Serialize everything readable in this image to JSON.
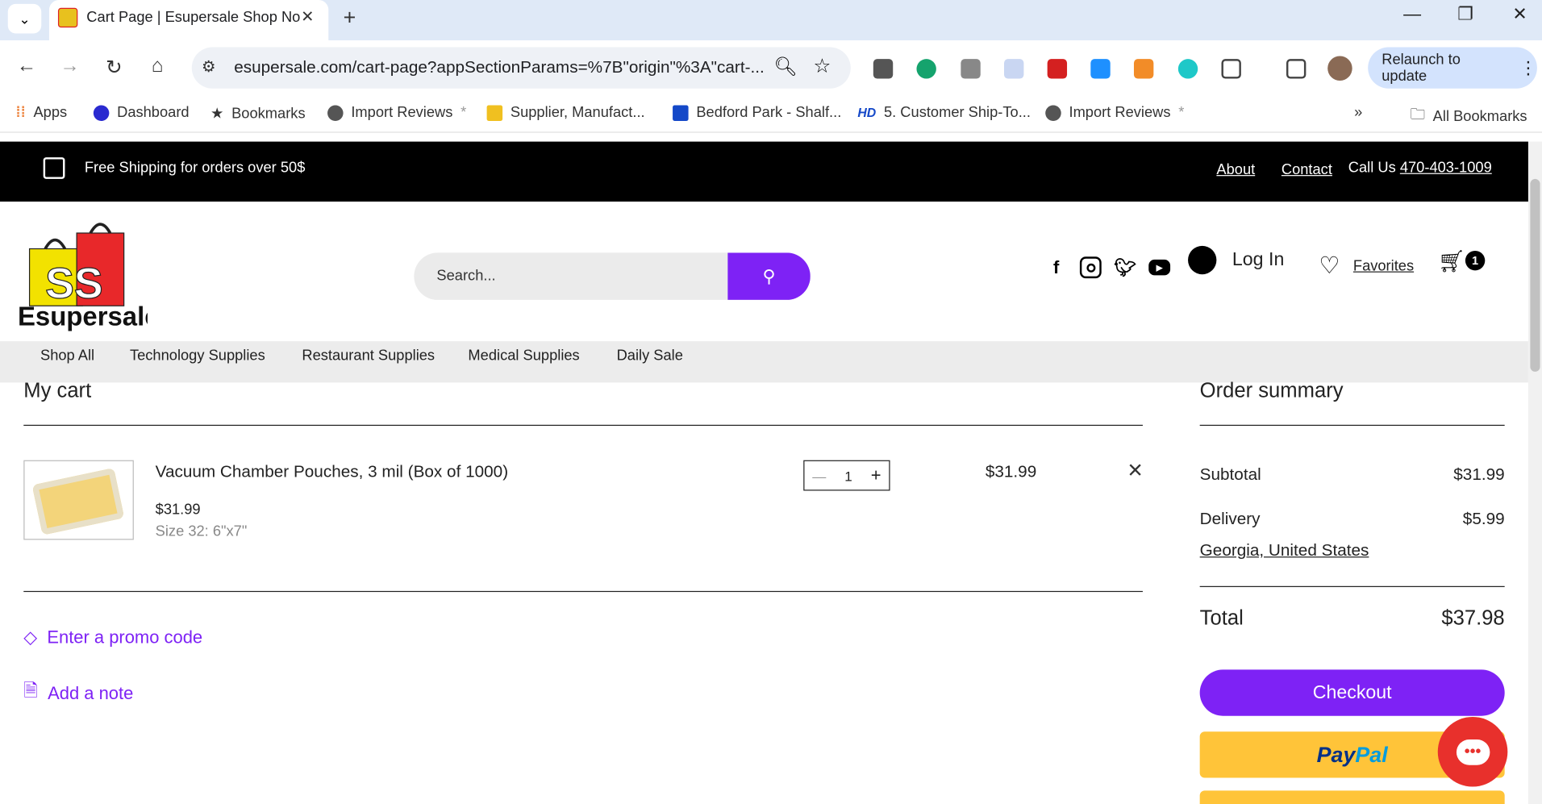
{
  "browser": {
    "tab_title": "Cart Page | Esupersale Shop No",
    "url": "esupersale.com/cart-page?appSectionParams=%7B\"origin\"%3A\"cart-...",
    "relaunch_label": "Relaunch to update",
    "bookmarks": [
      "Apps",
      "Dashboard",
      "Bookmarks",
      "Import Reviews",
      "Supplier, Manufact...",
      "Bedford Park - Shalf...",
      "5. Customer Ship-To...",
      "Import Reviews"
    ],
    "bookmark_prefix_hd": "HD",
    "all_bookmarks": "All Bookmarks"
  },
  "topbar": {
    "shipping": "Free Shipping for orders over 50$",
    "about": "About",
    "contact": "Contact",
    "call_prefix": "Call Us ",
    "phone": "470-403-1009"
  },
  "header": {
    "logo_letters": "SS",
    "logo_text": "Esupersale",
    "search_placeholder": "Search...",
    "login": "Log In",
    "favorites": "Favorites",
    "cart_count": "1"
  },
  "menu": [
    "Shop All",
    "Technology Supplies",
    "Restaurant Supplies",
    "Medical Supplies",
    "Daily Sale"
  ],
  "cart": {
    "title": "My cart",
    "item": {
      "name": "Vacuum Chamber Pouches, 3 mil (Box of 1000)",
      "price": "$31.99",
      "size": "Size 32: 6\"x7\"",
      "quantity": "1",
      "line_total": "$31.99"
    },
    "promo": "Enter a promo code",
    "note": "Add a note"
  },
  "summary": {
    "title": "Order summary",
    "subtotal_label": "Subtotal",
    "subtotal": "$31.99",
    "delivery_label": "Delivery",
    "delivery": "$5.99",
    "location": "Georgia, United States",
    "total_label": "Total",
    "total": "$37.98",
    "checkout": "Checkout",
    "paypal_a": "Pay",
    "paypal_b": "Pal"
  },
  "colors": {
    "accent": "#7e22f5",
    "paypal": "#ffc439",
    "chat": "#e8302c"
  }
}
